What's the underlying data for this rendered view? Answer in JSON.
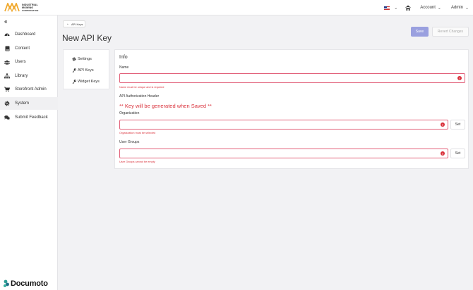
{
  "brand": {
    "logo_line1": "INDUSTRIAL",
    "logo_line2": "MOWING",
    "logo_line3": "CORPORATION",
    "accent": "#f0a82c"
  },
  "topbar": {
    "language_flag": "us-flag-icon",
    "account_label": "Account",
    "admin_label": "Admin"
  },
  "sidebar": {
    "items": [
      {
        "label": "Dashboard",
        "icon": "dashboard-icon"
      },
      {
        "label": "Content",
        "icon": "book-icon"
      },
      {
        "label": "Users",
        "icon": "users-icon"
      },
      {
        "label": "Library",
        "icon": "sitemap-icon"
      },
      {
        "label": "Storefront Admin",
        "icon": "cart-icon"
      },
      {
        "label": "System",
        "icon": "gear-icon",
        "active": true
      },
      {
        "label": "Submit Feedback",
        "icon": "comments-icon"
      }
    ],
    "footer_brand": "Documoto"
  },
  "breadcrumb": {
    "back_label": "API Keys"
  },
  "page": {
    "title": "New API Key"
  },
  "actions": {
    "save_label": "Save",
    "revert_label": "Revert Changes",
    "save_color": "#9aa0df"
  },
  "subnav": {
    "items": [
      "Settings",
      "API Keys",
      "Widget Keys"
    ]
  },
  "form": {
    "section_title": "Info",
    "name": {
      "label": "Name",
      "value": "",
      "error": "Name must be unique and is required"
    },
    "auth_header": {
      "label": "API Authorization Header",
      "message": "** Key will be generated when Saved **"
    },
    "organization": {
      "label": "Organization",
      "value": "",
      "error": "Organization must be selected",
      "set_label": "Set"
    },
    "user_groups": {
      "label": "User Groups",
      "value": "",
      "error": "User Groups cannot be empty",
      "set_label": "Set"
    },
    "error_color": "#d9303a"
  }
}
